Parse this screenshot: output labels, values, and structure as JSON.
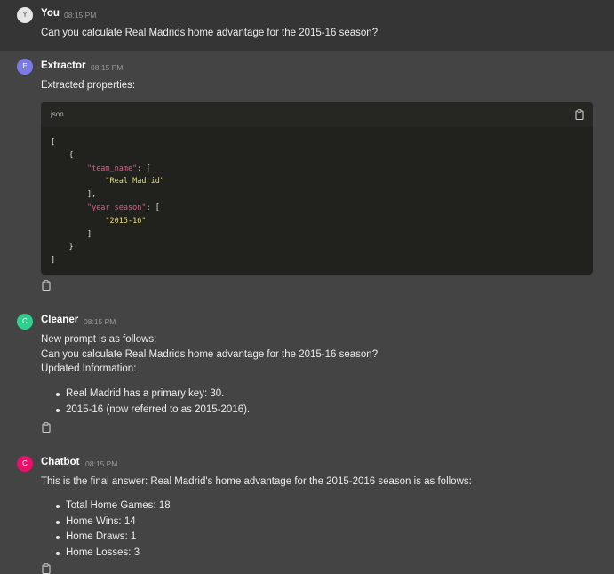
{
  "messages": {
    "user": {
      "avatar_letter": "Y",
      "author": "You",
      "time": "08:15 PM",
      "avatar_color": "#e6e6e6",
      "text": "Can you calculate Real Madrids home advantage for the 2015-16 season?"
    },
    "extractor": {
      "avatar_letter": "E",
      "author": "Extractor",
      "time": "08:15 PM",
      "avatar_color": "#7b7be8",
      "text": "Extracted properties:",
      "code": {
        "language": "json",
        "copy_icon": "clipboard-icon",
        "lines": {
          "l1": "[",
          "l2": "{",
          "l3_key": "\"team_name\"",
          "l3_rest": ": [",
          "l4": "\"Real Madrid\"",
          "l5": "],",
          "l6_key": "\"year_season\"",
          "l6_rest": ": [",
          "l7": "\"2015-16\"",
          "l8": "]",
          "l9": "}",
          "l10": "]"
        }
      },
      "copy_icon": "clipboard-icon"
    },
    "cleaner": {
      "avatar_letter": "C",
      "author": "Cleaner",
      "time": "08:15 PM",
      "avatar_color": "#2fcf8f",
      "lines": [
        "New prompt is as follows:",
        "Can you calculate Real Madrids home advantage for the 2015-16 season?",
        "Updated Information:"
      ],
      "bullets": [
        "Real Madrid has a primary key: 30.",
        "2015-16 (now referred to as 2015-2016)."
      ],
      "copy_icon": "clipboard-icon"
    },
    "chatbot": {
      "avatar_letter": "C",
      "author": "Chatbot",
      "time": "08:15 PM",
      "avatar_color": "#e8106b",
      "text": "This is the final answer: Real Madrid's home advantage for the 2015-2016 season is as follows:",
      "bullets": [
        "Total Home Games: 18",
        "Home Wins: 14",
        "Home Draws: 1",
        "Home Losses: 3"
      ],
      "copy_icon": "clipboard-icon"
    }
  }
}
